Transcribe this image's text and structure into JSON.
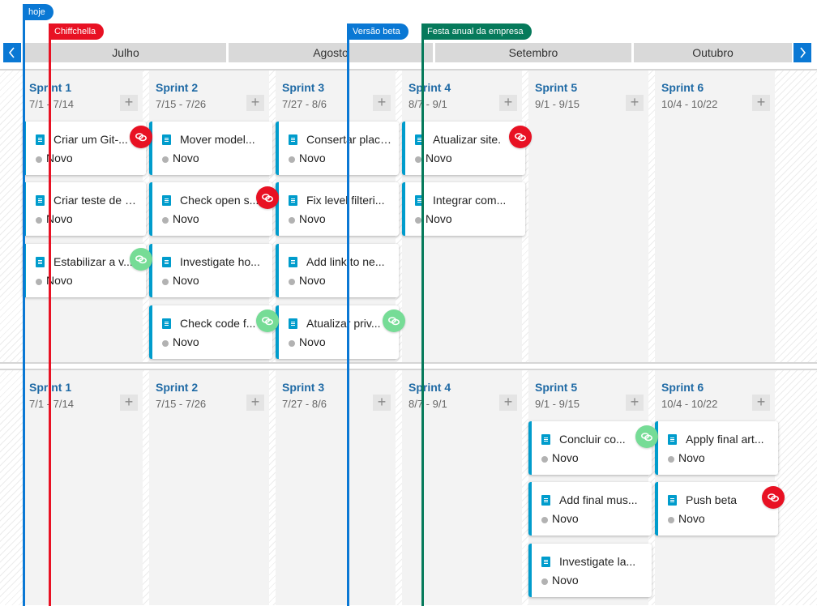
{
  "markers": [
    {
      "label": "hoje",
      "color": "#0a78d4"
    },
    {
      "label": "Chiffchella",
      "color": "#e81123"
    },
    {
      "label": "Versão beta",
      "color": "#0a78d4"
    },
    {
      "label": "Festa anual da empresa",
      "color": "#067a5b"
    }
  ],
  "nav": {
    "prev_icon": "chevron-left-icon",
    "next_icon": "chevron-right-icon"
  },
  "months": [
    "Julho",
    "Agosto",
    "Setembro",
    "Outubro"
  ],
  "colors": {
    "accent": "#0a78d4",
    "card_bar": "#009ccc",
    "dep_error": "#e81123",
    "dep_ok": "#76dc96",
    "sprint_title": "#1f6aa5"
  },
  "lanes": [
    {
      "sprints": [
        {
          "title": "Sprint 1",
          "dates": "7/1 - 7/14",
          "cards": [
            {
              "title": "Criar um Git-...",
              "state": "Novo",
              "link": "error"
            },
            {
              "title": "Criar teste de u...",
              "state": "Novo",
              "link": null
            },
            {
              "title": "Estabilizar a v...",
              "state": "Novo",
              "link": "ok"
            }
          ]
        },
        {
          "title": "Sprint 2",
          "dates": "7/15 - 7/26",
          "cards": [
            {
              "title": "Mover model...",
              "state": "Novo",
              "link": null
            },
            {
              "title": "Check open s...",
              "state": "Novo",
              "link": "error"
            },
            {
              "title": "Investigate ho...",
              "state": "Novo",
              "link": null
            },
            {
              "title": "Check code f...",
              "state": "Novo",
              "link": "ok"
            }
          ]
        },
        {
          "title": "Sprint 3",
          "dates": "7/27 - 8/6",
          "cards": [
            {
              "title": "Consertar placa...",
              "state": "Novo",
              "link": null
            },
            {
              "title": "Fix level filteri...",
              "state": "Novo",
              "link": null
            },
            {
              "title": "Add link to ne...",
              "state": "Novo",
              "link": null
            },
            {
              "title": "Atualizar priv...",
              "state": "Novo",
              "link": "ok"
            }
          ]
        },
        {
          "title": "Sprint 4",
          "dates": "8/7 - 9/1",
          "cards": [
            {
              "title": "Atualizar site.",
              "state": "Novo",
              "link": "error"
            },
            {
              "title": "Integrar com...",
              "state": "Novo",
              "link": null
            }
          ]
        },
        {
          "title": "Sprint 5",
          "dates": "9/1 - 9/15",
          "cards": []
        },
        {
          "title": "Sprint 6",
          "dates": "10/4 - 10/22",
          "cards": []
        }
      ]
    },
    {
      "sprints": [
        {
          "title": "Sprint 1",
          "dates": "7/1 - 7/14",
          "cards": []
        },
        {
          "title": "Sprint 2",
          "dates": "7/15 - 7/26",
          "cards": []
        },
        {
          "title": "Sprint 3",
          "dates": "7/27 - 8/6",
          "cards": []
        },
        {
          "title": "Sprint 4",
          "dates": "8/7 - 9/1",
          "cards": []
        },
        {
          "title": "Sprint 5",
          "dates": "9/1 - 9/15",
          "cards": [
            {
              "title": "Concluir co...",
              "state": "Novo",
              "link": "ok"
            },
            {
              "title": "Add final mus...",
              "state": "Novo",
              "link": null
            },
            {
              "title": "Investigate la...",
              "state": "Novo",
              "link": null
            }
          ]
        },
        {
          "title": "Sprint 6",
          "dates": "10/4 - 10/22",
          "cards": [
            {
              "title": "Apply final art...",
              "state": "Novo",
              "link": null
            },
            {
              "title": "Push beta",
              "state": "Novo",
              "link": "error"
            }
          ]
        }
      ]
    }
  ]
}
